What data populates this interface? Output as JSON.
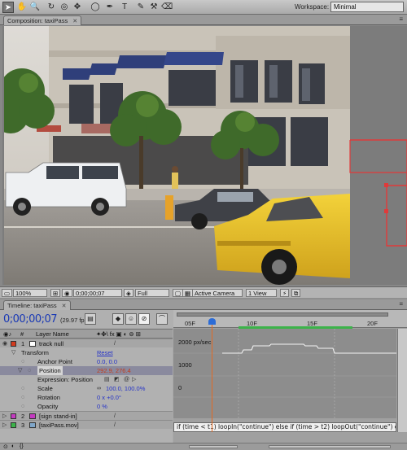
{
  "toolbar": {
    "tools": [
      "selection-tool-icon",
      "hand-tool-icon",
      "zoom-tool-icon",
      "rotation-tool-icon",
      "camera-orbit-icon",
      "pan-behind-icon",
      "rectangle-mask-icon",
      "pen-tool-icon",
      "text-tool-icon",
      "brush-tool-icon",
      "clone-stamp-icon",
      "eraser-icon"
    ],
    "workspace_label": "Workspace:",
    "workspace_value": "Minimal"
  },
  "composition": {
    "tab_label": "Composition: taxiPass",
    "zoom": "100%",
    "timecode": "0;00;00;07",
    "resolution": "Full",
    "camera": "Active Camera",
    "views": "1 View"
  },
  "timeline": {
    "tab_label": "Timeline: taxiPass",
    "current_time": "0;00;00;07",
    "fps": "(29.97 fps)",
    "column_label": "Layer Name",
    "ruler_ticks": [
      "05F",
      "10F",
      "15F",
      "20F"
    ],
    "graph_labels": [
      "2000 px/sec",
      "1000",
      "0"
    ],
    "expression": "if (time < t1) loopIn(\"continue\") else if (time > t2) loopOut(\"continue\") else value",
    "layers": [
      {
        "num": "1",
        "name": "track null",
        "color": "#d23a1e"
      },
      {
        "num": "2",
        "name": "[sign stand-in]",
        "color": "#c43bc0"
      },
      {
        "num": "3",
        "name": "[taxiPass.mov]",
        "color": "#3cb34a"
      }
    ],
    "properties": {
      "transform": "Transform",
      "reset": "Reset",
      "anchor_label": "Anchor Point",
      "anchor_value": "0.0, 0.0",
      "position_label": "Position",
      "position_value": "292.9, 276.4",
      "expression_label": "Expression: Position",
      "scale_label": "Scale",
      "scale_value": "100.0, 100.0%",
      "rotation_label": "Rotation",
      "rotation_value": "0 x +0.0°",
      "opacity_label": "Opacity",
      "opacity_value": "0 %"
    }
  }
}
